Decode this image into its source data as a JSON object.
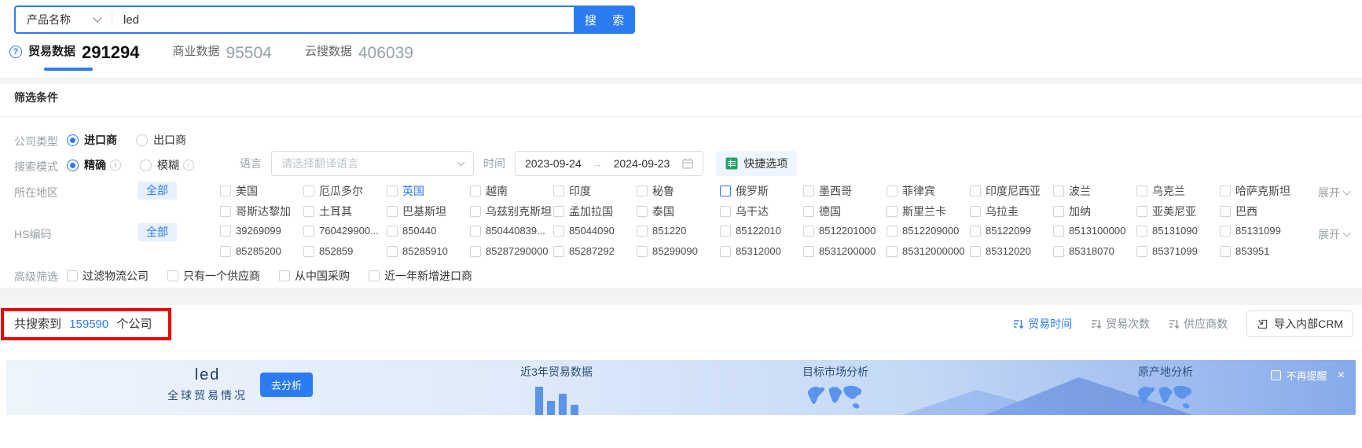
{
  "colors": {
    "primary": "#2b7bf3",
    "chip_bg": "#e7f1fd",
    "annotation_red": "#ec0000",
    "quick_icon_green": "#21a366",
    "banner_icon_blue": "#5b94ea"
  },
  "search_bar": {
    "category": "产品名称",
    "query": "led",
    "button": "搜 索"
  },
  "tabs": [
    {
      "label": "贸易数据",
      "count": "291294",
      "active": true
    },
    {
      "label": "商业数据",
      "count": "95504",
      "active": false
    },
    {
      "label": "云搜数据",
      "count": "406039",
      "active": false
    }
  ],
  "filter": {
    "title": "筛选条件",
    "company_type": {
      "label": "公司类型",
      "importer": "进口商",
      "exporter": "出口商"
    },
    "search_mode": {
      "label": "搜索模式",
      "exact": "精确",
      "fuzzy": "模糊",
      "language_label": "语言",
      "language_placeholder": "请选择翻译语言",
      "time_label": "时间",
      "date_start": "2023-09-24",
      "date_arrow": "→",
      "date_end": "2024-09-23",
      "quick_button": "快捷选项"
    },
    "region": {
      "label": "所在地区",
      "all": "全部",
      "expand": "展开",
      "row1": [
        {
          "label": "美国"
        },
        {
          "label": "厄瓜多尔"
        },
        {
          "label": "英国",
          "text_blue": true
        },
        {
          "label": "越南"
        },
        {
          "label": "印度"
        },
        {
          "label": "秘鲁"
        },
        {
          "label": "俄罗斯",
          "box_blue": true
        },
        {
          "label": "墨西哥"
        },
        {
          "label": "菲律宾"
        },
        {
          "label": "印度尼西亚"
        },
        {
          "label": "波兰"
        },
        {
          "label": "乌克兰"
        },
        {
          "label": "哈萨克斯坦"
        }
      ],
      "row2": [
        {
          "label": "哥斯达黎加"
        },
        {
          "label": "土耳其"
        },
        {
          "label": "巴基斯坦"
        },
        {
          "label": "乌兹别克斯坦"
        },
        {
          "label": "孟加拉国"
        },
        {
          "label": "泰国"
        },
        {
          "label": "乌干达"
        },
        {
          "label": "德国"
        },
        {
          "label": "斯里兰卡"
        },
        {
          "label": "乌拉圭"
        },
        {
          "label": "加纳"
        },
        {
          "label": "亚美尼亚"
        },
        {
          "label": "巴西"
        }
      ]
    },
    "hs_code": {
      "label": "HS编码",
      "all": "全部",
      "expand": "展开",
      "row1": [
        {
          "label": "39269099"
        },
        {
          "label": "760429900..."
        },
        {
          "label": "850440"
        },
        {
          "label": "850440839..."
        },
        {
          "label": "85044090"
        },
        {
          "label": "851220"
        },
        {
          "label": "85122010"
        },
        {
          "label": "8512201000"
        },
        {
          "label": "8512209000"
        },
        {
          "label": "85122099"
        },
        {
          "label": "8513100000"
        },
        {
          "label": "85131090"
        },
        {
          "label": "85131099"
        }
      ],
      "row2": [
        {
          "label": "85285200"
        },
        {
          "label": "852859"
        },
        {
          "label": "85285910"
        },
        {
          "label": "85287290000"
        },
        {
          "label": "85287292"
        },
        {
          "label": "85299090"
        },
        {
          "label": "85312000"
        },
        {
          "label": "8531200000"
        },
        {
          "label": "85312000000"
        },
        {
          "label": "85312020"
        },
        {
          "label": "85318070"
        },
        {
          "label": "85371099"
        },
        {
          "label": "853951"
        }
      ]
    },
    "advanced": {
      "label": "高级筛选",
      "options": [
        {
          "label": "过滤物流公司"
        },
        {
          "label": "只有一个供应商"
        },
        {
          "label": "从中国采购"
        },
        {
          "label": "近一年新增进口商"
        }
      ]
    }
  },
  "results": {
    "prefix": "共搜索到",
    "count": "159590",
    "suffix": "个公司",
    "sorts": [
      {
        "label": "贸易时间",
        "active": true
      },
      {
        "label": "贸易次数",
        "active": false
      },
      {
        "label": "供应商数",
        "active": false
      }
    ],
    "import_crm": "导入内部CRM"
  },
  "banner": {
    "keyword": "led",
    "subtitle": "全球贸易情况",
    "analyze": "去分析",
    "card_trade": "近3年贸易数据",
    "card_market": "目标市场分析",
    "card_origin": "原产地分析",
    "dismiss": "不再提醒",
    "close": "×"
  }
}
